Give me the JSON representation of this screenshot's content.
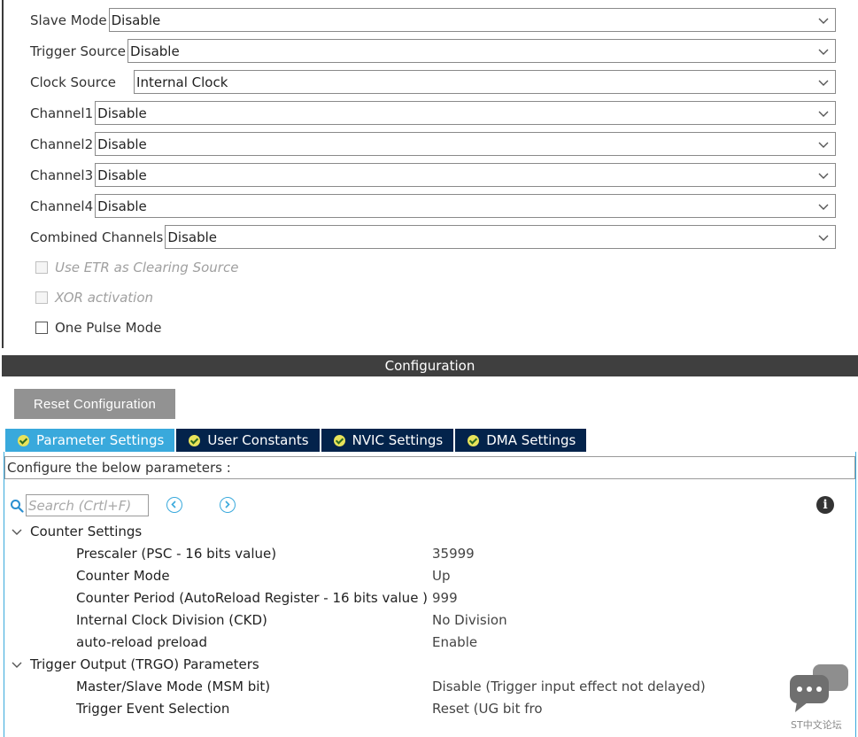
{
  "mode": {
    "rows": [
      {
        "label": "Slave Mode",
        "value": "Disable"
      },
      {
        "label": "Trigger Source",
        "value": "Disable"
      },
      {
        "label": "Clock Source",
        "value": "Internal Clock"
      },
      {
        "label": "Channel1",
        "value": "Disable"
      },
      {
        "label": "Channel2",
        "value": "Disable"
      },
      {
        "label": "Channel3",
        "value": "Disable"
      },
      {
        "label": "Channel4",
        "value": "Disable"
      },
      {
        "label": "Combined Channels",
        "value": "Disable"
      }
    ],
    "checkboxes": [
      {
        "label": "Use ETR as Clearing Source",
        "checked": false,
        "enabled": false
      },
      {
        "label": "XOR activation",
        "checked": false,
        "enabled": false
      },
      {
        "label": "One Pulse Mode",
        "checked": false,
        "enabled": true
      }
    ]
  },
  "config": {
    "header": "Configuration",
    "reset_label": "Reset Configuration",
    "tabs": [
      {
        "label": "Parameter Settings",
        "active": true
      },
      {
        "label": "User Constants",
        "active": false
      },
      {
        "label": "NVIC Settings",
        "active": false
      },
      {
        "label": "DMA Settings",
        "active": false
      }
    ],
    "hint": "Configure the below parameters :",
    "search_placeholder": "Search (Crtl+F)",
    "groups": [
      {
        "title": "Counter Settings",
        "params": [
          {
            "name": "Prescaler (PSC - 16 bits value)",
            "value": "35999"
          },
          {
            "name": "Counter Mode",
            "value": "Up"
          },
          {
            "name": "Counter Period (AutoReload Register - 16 bits value )",
            "value": "999"
          },
          {
            "name": "Internal Clock Division (CKD)",
            "value": "No Division"
          },
          {
            "name": "auto-reload preload",
            "value": "Enable"
          }
        ]
      },
      {
        "title": "Trigger Output (TRGO) Parameters",
        "params": [
          {
            "name": "Master/Slave Mode (MSM bit)",
            "value": "Disable (Trigger input effect not delayed)"
          },
          {
            "name": "Trigger Event Selection",
            "value": "Reset (UG bit fro"
          }
        ]
      }
    ]
  },
  "watermark": {
    "text": "ST中文论坛"
  },
  "colors": {
    "tab_active": "#39a9dc",
    "tab_inactive": "#03234b",
    "header_bg": "#3f3f3f",
    "button_bg": "#929292"
  }
}
